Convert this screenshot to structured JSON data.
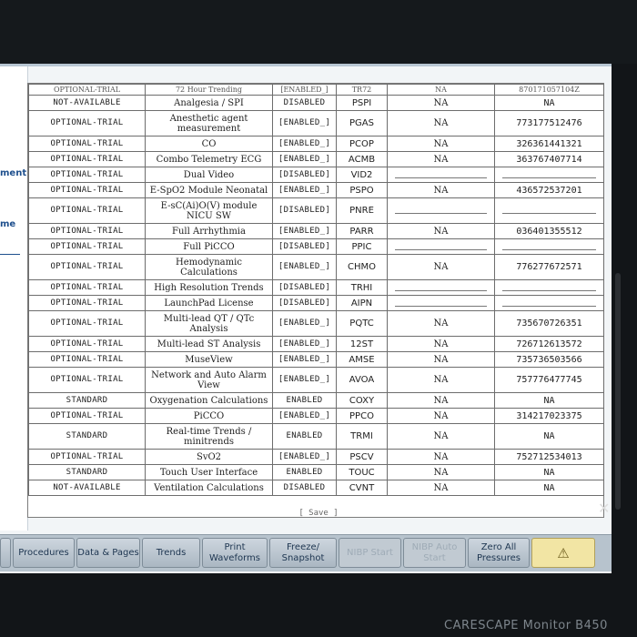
{
  "left_labels": [
    "ment",
    "me"
  ],
  "header_partial": [
    "OPTIONAL-TRIAL",
    "72 Hour Trending",
    "[ENABLED_]",
    "TR72",
    "NA",
    "870171057104Z"
  ],
  "options": [
    {
      "status": "NOT-AVAILABLE",
      "name": "Analgesia / SPI",
      "state": "DISABLED",
      "code": "PSPI",
      "trial": "NA",
      "key": "NA"
    },
    {
      "status": "OPTIONAL-TRIAL",
      "name": "Anesthetic agent measurement",
      "state": "[ENABLED_]",
      "code": "PGAS",
      "trial": "NA",
      "key": "773177512476"
    },
    {
      "status": "OPTIONAL-TRIAL",
      "name": "CO",
      "state": "[ENABLED_]",
      "code": "PCOP",
      "trial": "NA",
      "key": "326361441321"
    },
    {
      "status": "OPTIONAL-TRIAL",
      "name": "Combo Telemetry ECG",
      "state": "[ENABLED_]",
      "code": "ACMB",
      "trial": "NA",
      "key": "363767407714"
    },
    {
      "status": "OPTIONAL-TRIAL",
      "name": "Dual Video",
      "state": "[DISABLED]",
      "code": "VID2",
      "trial": "",
      "key": ""
    },
    {
      "status": "OPTIONAL-TRIAL",
      "name": "E-SpO2 Module Neonatal",
      "state": "[ENABLED_]",
      "code": "PSPO",
      "trial": "NA",
      "key": "436572537201"
    },
    {
      "status": "OPTIONAL-TRIAL",
      "name": "E-sC(Ai)O(V) module NICU SW",
      "state": "[DISABLED]",
      "code": "PNRE",
      "trial": "",
      "key": ""
    },
    {
      "status": "OPTIONAL-TRIAL",
      "name": "Full Arrhythmia",
      "state": "[ENABLED_]",
      "code": "PARR",
      "trial": "NA",
      "key": "036401355512"
    },
    {
      "status": "OPTIONAL-TRIAL",
      "name": "Full PiCCO",
      "state": "[DISABLED]",
      "code": "PPIC",
      "trial": "",
      "key": ""
    },
    {
      "status": "OPTIONAL-TRIAL",
      "name": "Hemodynamic Calculations",
      "state": "[ENABLED_]",
      "code": "CHMO",
      "trial": "NA",
      "key": "776277672571"
    },
    {
      "status": "OPTIONAL-TRIAL",
      "name": "High Resolution Trends",
      "state": "[DISABLED]",
      "code": "TRHI",
      "trial": "",
      "key": ""
    },
    {
      "status": "OPTIONAL-TRIAL",
      "name": "LaunchPad License",
      "state": "[DISABLED]",
      "code": "AIPN",
      "trial": "",
      "key": ""
    },
    {
      "status": "OPTIONAL-TRIAL",
      "name": "Multi-lead QT / QTc Analysis",
      "state": "[ENABLED_]",
      "code": "PQTC",
      "trial": "NA",
      "key": "735670726351"
    },
    {
      "status": "OPTIONAL-TRIAL",
      "name": "Multi-lead ST Analysis",
      "state": "[ENABLED_]",
      "code": "12ST",
      "trial": "NA",
      "key": "726712613572"
    },
    {
      "status": "OPTIONAL-TRIAL",
      "name": "MuseView",
      "state": "[ENABLED_]",
      "code": "AMSE",
      "trial": "NA",
      "key": "735736503566"
    },
    {
      "status": "OPTIONAL-TRIAL",
      "name": "Network and Auto Alarm View",
      "state": "[ENABLED_]",
      "code": "AVOA",
      "trial": "NA",
      "key": "757776477745"
    },
    {
      "status": "STANDARD",
      "name": "Oxygenation Calculations",
      "state": "ENABLED",
      "code": "COXY",
      "trial": "NA",
      "key": "NA"
    },
    {
      "status": "OPTIONAL-TRIAL",
      "name": "PiCCO",
      "state": "[ENABLED_]",
      "code": "PPCO",
      "trial": "NA",
      "key": "314217023375"
    },
    {
      "status": "STANDARD",
      "name": "Real-time Trends / minitrends",
      "state": "ENABLED",
      "code": "TRMI",
      "trial": "NA",
      "key": "NA"
    },
    {
      "status": "OPTIONAL-TRIAL",
      "name": "SvO2",
      "state": "[ENABLED_]",
      "code": "PSCV",
      "trial": "NA",
      "key": "752712534013"
    },
    {
      "status": "STANDARD",
      "name": "Touch User Interface",
      "state": "ENABLED",
      "code": "TOUC",
      "trial": "NA",
      "key": "NA"
    },
    {
      "status": "NOT-AVAILABLE",
      "name": "Ventilation Calculations",
      "state": "DISABLED",
      "code": "CVNT",
      "trial": "NA",
      "key": "NA"
    }
  ],
  "save_label": "[ Save ]",
  "toolbar": [
    {
      "label": "",
      "state": "normal"
    },
    {
      "label": "Procedures",
      "state": "normal"
    },
    {
      "label": "Data & Pages",
      "state": "normal"
    },
    {
      "label": "Trends",
      "state": "normal"
    },
    {
      "label": "Print Waveforms",
      "state": "normal"
    },
    {
      "label": "Freeze/ Snapshot",
      "state": "normal"
    },
    {
      "label": "NIBP Start",
      "state": "disabled"
    },
    {
      "label": "NIBP Auto Start",
      "state": "disabled"
    },
    {
      "label": "Zero All Pressures",
      "state": "normal"
    },
    {
      "label": "",
      "state": "alarm"
    }
  ],
  "brand": "CARESCAPE Monitor B450",
  "x_mark": "✕"
}
